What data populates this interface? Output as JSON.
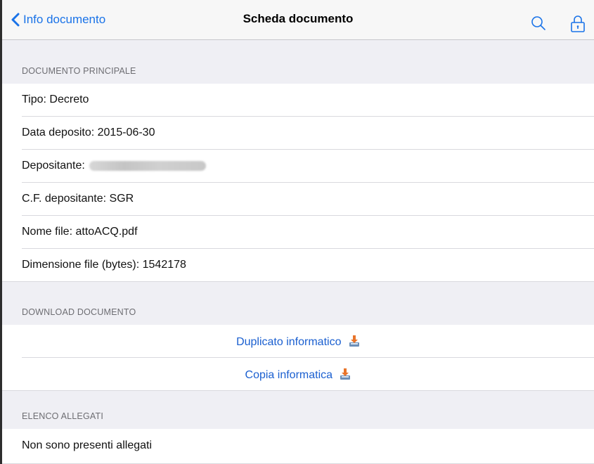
{
  "navbar": {
    "back_label": "Info documento",
    "title": "Scheda documento",
    "accent_color": "#1a73e8"
  },
  "sections": {
    "main": {
      "header": "DOCUMENTO PRINCIPALE",
      "rows": [
        "Tipo: Decreto",
        "Data deposito: 2015-06-30",
        "Depositante:",
        "C.F. depositante: SGR",
        "Nome file: attoACQ.pdf",
        "Dimensione file (bytes): 1542178"
      ]
    },
    "download": {
      "header": "DOWNLOAD DOCUMENTO",
      "links": [
        "Duplicato informatico",
        "Copia informatica"
      ]
    },
    "attachments": {
      "header": "ELENCO ALLEGATI",
      "rows": [
        "Non sono presenti allegati"
      ]
    }
  },
  "icons": [
    "chevron-left-icon",
    "search-icon",
    "lock-icon",
    "download-icon"
  ]
}
